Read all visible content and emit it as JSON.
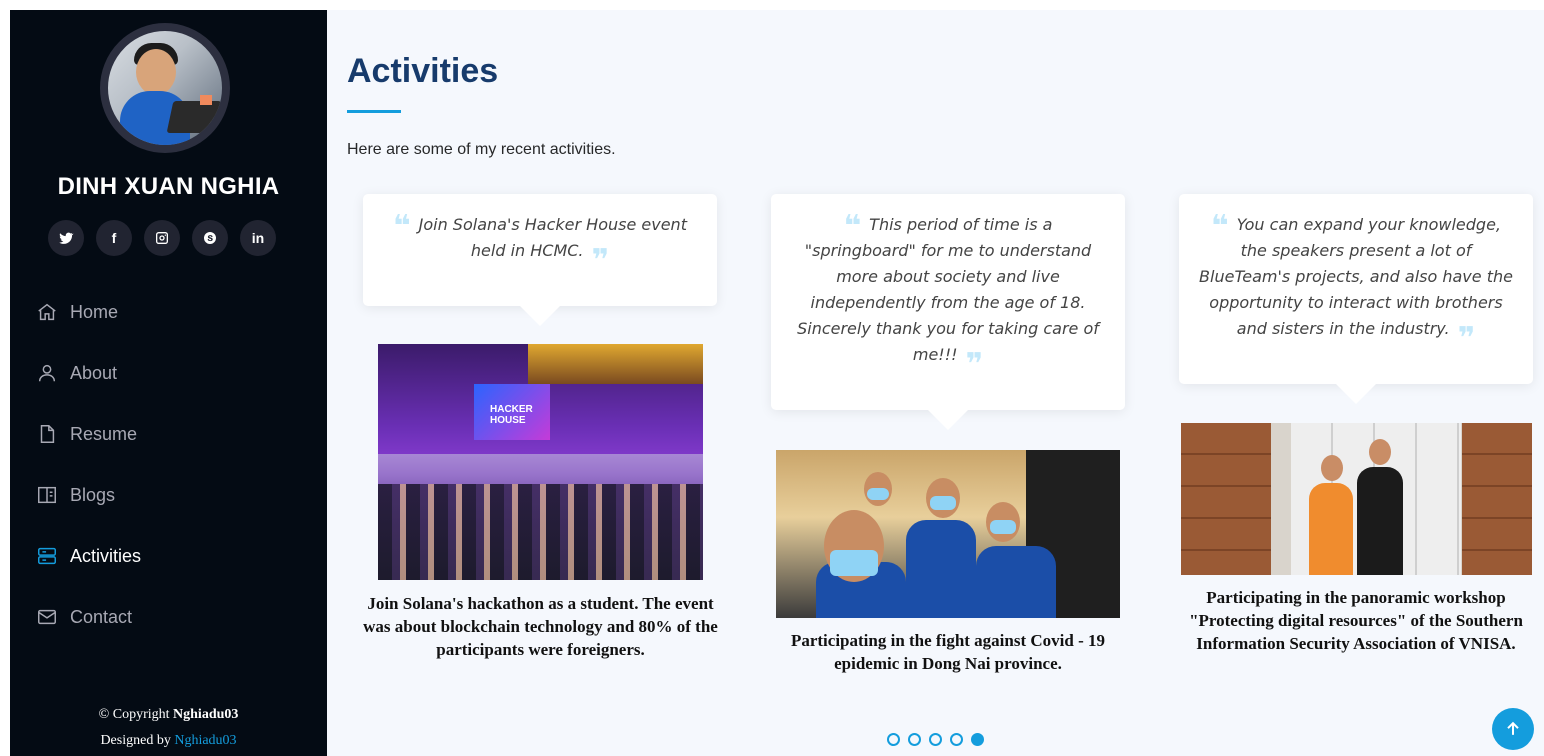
{
  "sidebar": {
    "name": "DINH XUAN NGHIA",
    "socials": [
      {
        "label": "twitter",
        "icon": "twitter-icon"
      },
      {
        "label": "f",
        "icon": "facebook-icon"
      },
      {
        "label": "instagram",
        "icon": "instagram-icon"
      },
      {
        "label": "skype",
        "icon": "skype-icon"
      },
      {
        "label": "in",
        "icon": "linkedin-icon"
      }
    ],
    "nav": [
      {
        "label": "Home",
        "icon": "home-icon"
      },
      {
        "label": "About",
        "icon": "person-icon"
      },
      {
        "label": "Resume",
        "icon": "file-icon"
      },
      {
        "label": "Blogs",
        "icon": "book-icon"
      },
      {
        "label": "Activities",
        "icon": "server-icon",
        "active": true
      },
      {
        "label": "Contact",
        "icon": "envelope-icon"
      }
    ],
    "copyright_prefix": "© Copyright",
    "copyright_owner": "Nghiadu03",
    "designed_prefix": "Designed by",
    "designed_by": "Nghiadu03"
  },
  "main": {
    "title": "Activities",
    "subtitle": "Here are some of my recent activities.",
    "cards": [
      {
        "quote": "Join Solana's Hacker House event held in HCMC.",
        "caption": "Join Solana's hackathon as a student. The event was about blockchain technology and 80% of the participants were foreigners.",
        "screen_text": "HACKER HOUSE"
      },
      {
        "quote": "This period of time is a \"springboard\" for me to understand more about society and live independently from the age of 18. Sincerely thank you for taking care of me!!!",
        "caption": "Participating in the fight against Covid - 19 epidemic in Dong Nai province."
      },
      {
        "quote": "You can expand your knowledge, the speakers present a lot of BlueTeam's projects, and also have the opportunity to interact with brothers and sisters in the industry.",
        "caption": "Participating in the panoramic workshop \"Protecting digital resources\" of the Southern Information Security Association of VNISA."
      }
    ],
    "pagination": {
      "count": 5,
      "active_index": 4
    }
  },
  "colors": {
    "accent": "#149ddd",
    "sidebar_bg": "#040b14",
    "title": "#173b6c",
    "main_bg": "#f5f8fd"
  }
}
